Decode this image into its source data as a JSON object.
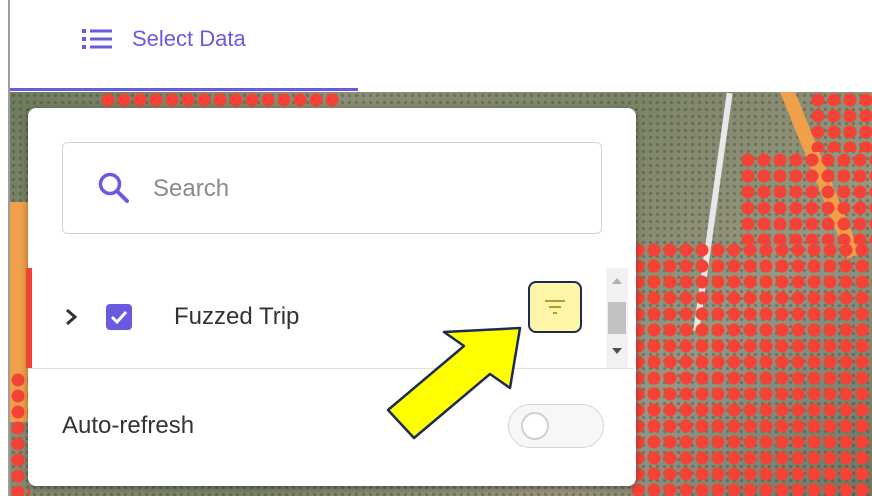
{
  "header": {
    "tab_label": "Select Data"
  },
  "search": {
    "placeholder": "Search",
    "value": ""
  },
  "layers": [
    {
      "name": "Fuzzed Trip",
      "checked": true
    }
  ],
  "settings": {
    "auto_refresh_label": "Auto-refresh",
    "auto_refresh_on": false
  },
  "colors": {
    "accent": "#6a5ae0",
    "data_points": "#f44336",
    "highlight": "#fdf6a8",
    "arrow": "#ffff00"
  },
  "icons": [
    "list-icon",
    "search-icon",
    "chevron-right-icon",
    "check-icon",
    "filter-icon",
    "callout-arrow-icon"
  ]
}
